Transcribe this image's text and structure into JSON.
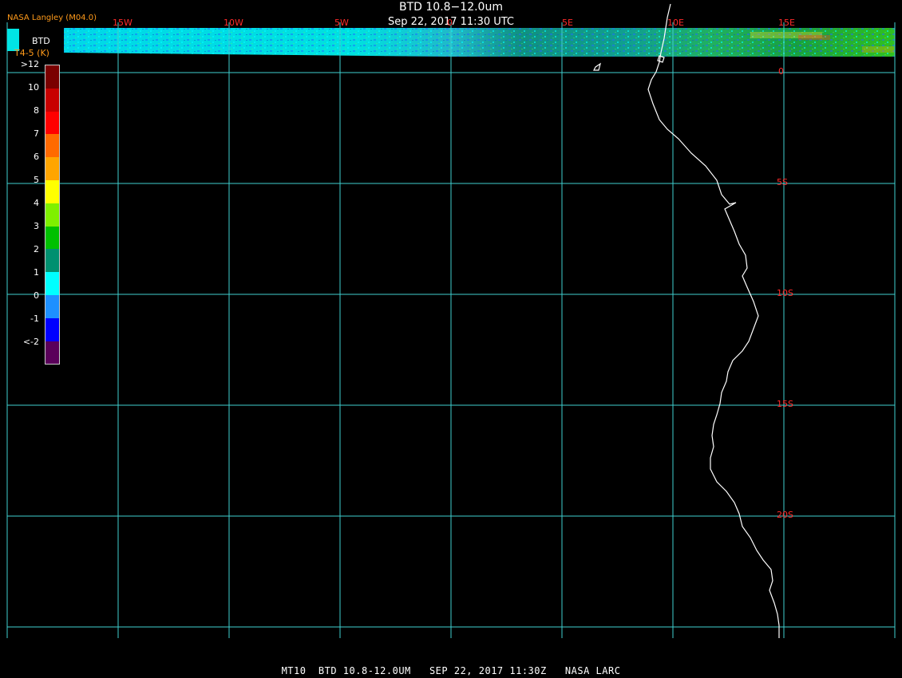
{
  "header": {
    "title": "BTD 10.8−12.0um",
    "subtitle": "Sep 22, 2017 11:30 UTC",
    "provider": "NASA Langley (M04.0)"
  },
  "footer": {
    "caption": "MT10  BTD 10.8-12.0UM   SEP 22, 2017 11:30Z   NASA LARC"
  },
  "legend": {
    "title": "BTD",
    "units": "T4-5 (K)",
    "labels": [
      ">12",
      "10",
      "8",
      "7",
      "6",
      "5",
      "4",
      "3",
      "2",
      "1",
      "0",
      "-1",
      "<-2"
    ],
    "colors": [
      "#7a0000",
      "#c80000",
      "#ff0000",
      "#ff6a00",
      "#ffa500",
      "#ffff00",
      "#7ff000",
      "#00c000",
      "#009070",
      "#00ffff",
      "#1e90ff",
      "#0000ff",
      "#5a005a"
    ]
  },
  "map": {
    "lon_labels": [
      "15W",
      "10W",
      "5W",
      "0",
      "5E",
      "10E",
      "15E"
    ],
    "lat_labels": [
      "0",
      "5S",
      "10S",
      "15S",
      "20S"
    ],
    "grid_color": "#3fd0d0",
    "coast_color": "#ffffff"
  }
}
